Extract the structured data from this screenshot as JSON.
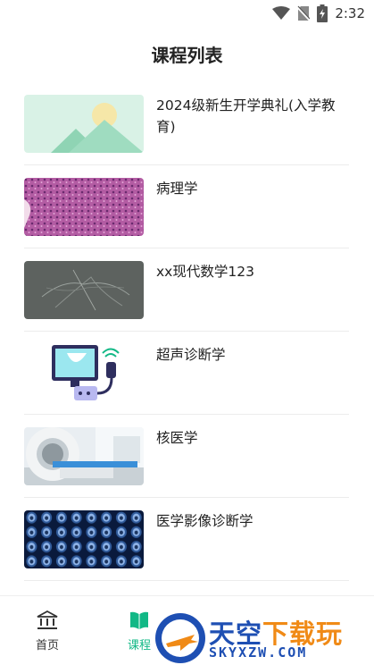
{
  "status_bar": {
    "time": "2:32"
  },
  "page": {
    "title": "课程列表"
  },
  "courses": [
    {
      "title": "2024级新生开学典礼(入学教育)",
      "thumbnail": "placeholder-mountain-image"
    },
    {
      "title": "病理学",
      "thumbnail": "pathology-tissue-image"
    },
    {
      "title": "xx现代数学123",
      "thumbnail": "gray-texture-image"
    },
    {
      "title": "超声诊断学",
      "thumbnail": "ultrasound-machine-illustration"
    },
    {
      "title": "核医学",
      "thumbnail": "ct-scanner-photo"
    },
    {
      "title": "医学影像诊断学",
      "thumbnail": "ct-scan-grid-image"
    }
  ],
  "tabbar": {
    "home_label": "首页",
    "courses_label": "课程",
    "active_color": "#12b886"
  },
  "watermark": {
    "line1_a": "天空",
    "line1_b": "下载玩",
    "line2": "SKYXZW.COM"
  }
}
